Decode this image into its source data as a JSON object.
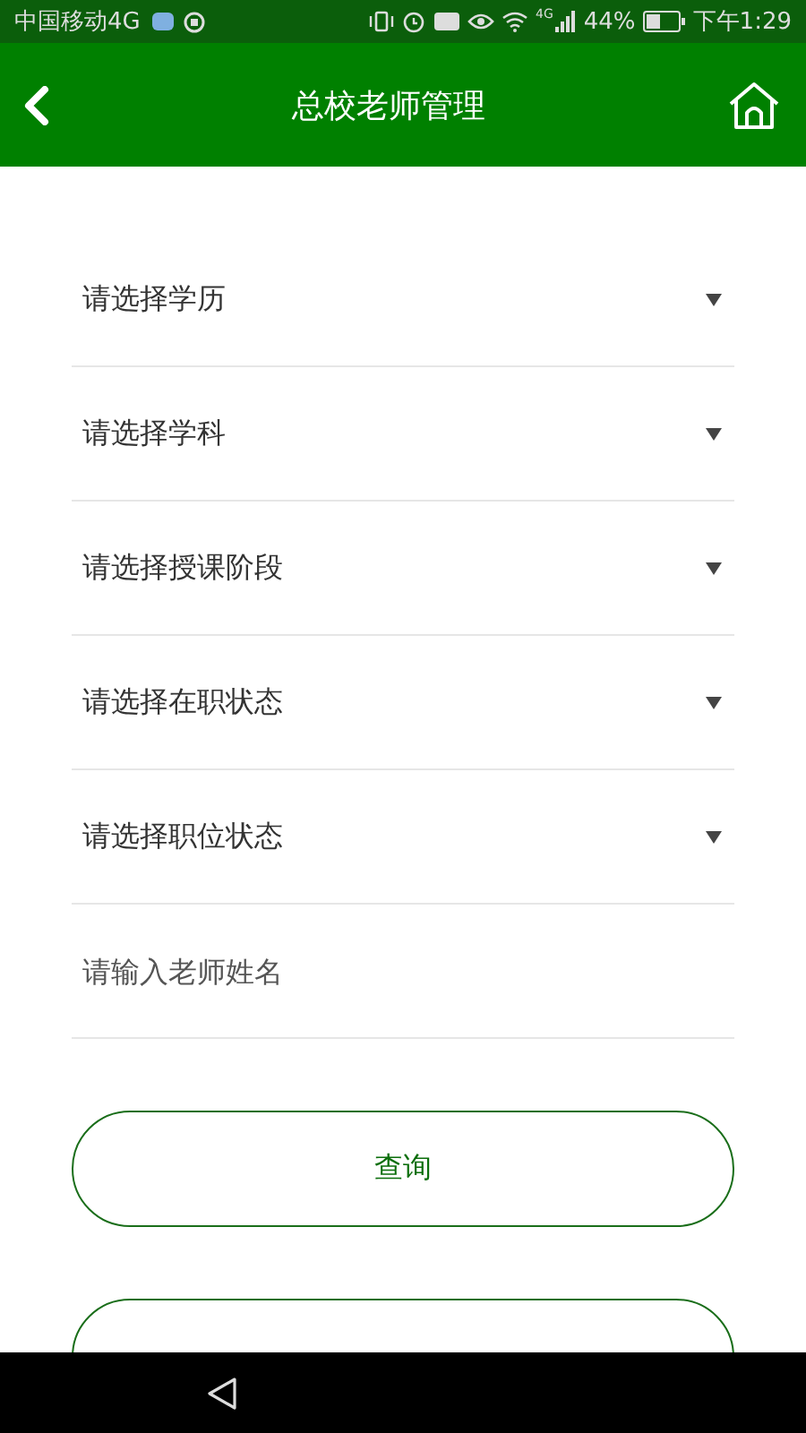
{
  "status_bar": {
    "carrier": "中国移动4G",
    "network": "4G",
    "battery": "44%",
    "time": "下午1:29"
  },
  "header": {
    "title": "总校老师管理"
  },
  "fields": [
    {
      "kind": "select",
      "placeholder": "请选择学历"
    },
    {
      "kind": "select",
      "placeholder": "请选择学科"
    },
    {
      "kind": "select",
      "placeholder": "请选择授课阶段"
    },
    {
      "kind": "select",
      "placeholder": "请选择在职状态"
    },
    {
      "kind": "select",
      "placeholder": "请选择职位状态"
    },
    {
      "kind": "input",
      "placeholder": "请输入老师姓名"
    }
  ],
  "buttons": [
    {
      "kind": "outline",
      "label": "查询"
    },
    {
      "kind": "outline"
    }
  ]
}
